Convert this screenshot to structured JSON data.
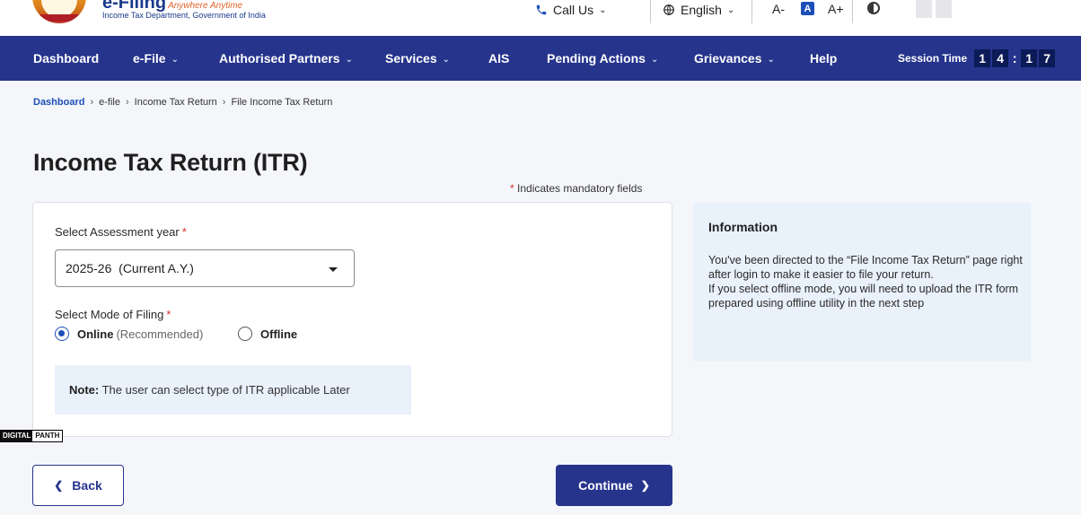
{
  "header": {
    "logo_title": "e-Filing",
    "logo_tagline": "Anywhere Anytime",
    "logo_subtitle": "Income Tax Department, Government of India",
    "call_us": "Call Us",
    "language": "English",
    "font_decrease": "A-",
    "font_normal": "A",
    "font_increase": "A+"
  },
  "nav": {
    "items": [
      {
        "label": "Dashboard",
        "dropdown": false
      },
      {
        "label": "e-File",
        "dropdown": true
      },
      {
        "label": "Authorised Partners",
        "dropdown": true
      },
      {
        "label": "Services",
        "dropdown": true
      },
      {
        "label": "AIS",
        "dropdown": false
      },
      {
        "label": "Pending Actions",
        "dropdown": true
      },
      {
        "label": "Grievances",
        "dropdown": true
      },
      {
        "label": "Help",
        "dropdown": false
      }
    ],
    "session_label": "Session Time",
    "session_digits": [
      "1",
      "4",
      "1",
      "7"
    ]
  },
  "breadcrumb": [
    "Dashboard",
    "e-file",
    "Income Tax Return",
    "File Income Tax Return"
  ],
  "page_title": "Income Tax Return (ITR)",
  "mandatory_note": "Indicates mandatory fields",
  "form": {
    "assessment_label": "Select Assessment year",
    "assessment_value": "2025-26  (Current A.Y.)",
    "mode_label": "Select Mode of Filing",
    "mode_options": [
      {
        "label": "Online",
        "hint": "(Recommended)",
        "selected": true
      },
      {
        "label": "Offline",
        "hint": "",
        "selected": false
      }
    ],
    "note_label": "Note:",
    "note_text": "The user can select type of ITR applicable Later"
  },
  "info": {
    "title": "Information",
    "para1": "You've been directed to the “File Income Tax Return” page right after login to make it easier to file your return.",
    "para2": "If you select offline mode, you will need to upload the ITR form prepared using offline utility in the next step"
  },
  "watermark": {
    "part1": "DIGITAL",
    "part2": "PANTH"
  },
  "buttons": {
    "back": "Back",
    "continue": "Continue"
  },
  "colors": {
    "nav_bg": "#26348c",
    "accent": "#1d4fb8",
    "info_bg": "#e9f1fb",
    "required": "#d0302f"
  }
}
